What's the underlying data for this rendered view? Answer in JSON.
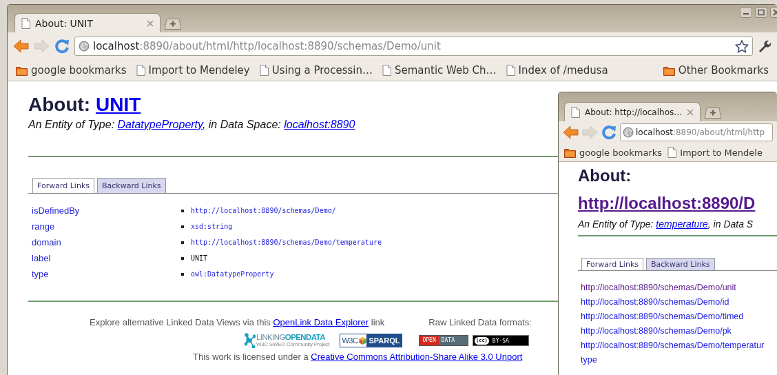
{
  "windows": [
    {
      "kind": "main",
      "tabs": [
        {
          "title": "About: UNIT",
          "selected": true
        }
      ],
      "nav": [
        {
          "kind": "back",
          "disabled": false
        },
        {
          "kind": "forward",
          "disabled": true
        },
        {
          "kind": "reload",
          "disabled": false
        }
      ],
      "address": {
        "host": "localhost",
        "rest": ":8890/about/html/http/localhost:8890/schemas/Demo/unit"
      },
      "bookmarks": [
        {
          "kind": "folder",
          "label": "google bookmarks"
        },
        {
          "kind": "page",
          "label": "Import to Mendeley"
        },
        {
          "kind": "page",
          "label": "Using a Processin…"
        },
        {
          "kind": "page",
          "label": "Semantic Web Ch…"
        },
        {
          "kind": "page",
          "label": "Index of /medusa"
        }
      ],
      "other_bookmarks": "Other Bookmarks",
      "page": {
        "kind": "properties",
        "heading": "About:",
        "heading_link": {
          "text": "UNIT",
          "visited": false
        },
        "subtitle": [
          {
            "text": "An Entity of Type: ",
            "link": false
          },
          {
            "text": "DatatypeProperty",
            "link": true
          },
          {
            "text": ", in Data Space: ",
            "link": false
          },
          {
            "text": "localhost:8890",
            "link": true
          }
        ],
        "link_tabs": [
          {
            "label": "Forward Links",
            "selected": true
          },
          {
            "label": "Backward Links",
            "selected": false
          }
        ],
        "properties": [
          {
            "name": "isDefinedBy",
            "values": [
              {
                "text": "http://localhost:8890/schemas/Demo/",
                "link": true
              }
            ]
          },
          {
            "name": "range",
            "values": [
              {
                "text": "xsd:string",
                "link": true
              }
            ]
          },
          {
            "name": "domain",
            "values": [
              {
                "text": "http://localhost:8890/schemas/Demo/temperature",
                "link": true
              }
            ]
          },
          {
            "name": "label",
            "values": [
              {
                "text": "UNIT",
                "link": false
              }
            ]
          },
          {
            "name": "type",
            "values": [
              {
                "text": "owl:DatatypeProperty",
                "link": true
              }
            ]
          }
        ],
        "footer": {
          "explore": [
            {
              "text": "Explore alternative Linked Data Views via this ",
              "link": false
            },
            {
              "text": "OpenLink Data Explorer",
              "link": true
            },
            {
              "text": " link",
              "link": false
            }
          ],
          "raw_formats": "Raw Linked Data formats:",
          "badges": [
            {
              "kind": "lod",
              "texts": [
                "LINKING",
                "OPENDATA",
                "W3C SWEO Community Project"
              ]
            },
            {
              "kind": "sparql",
              "texts": [
                "W3C",
                "SPARQL"
              ]
            },
            {
              "kind": "opendata",
              "texts": [
                "OPEN",
                "DATA"
              ]
            },
            {
              "kind": "cc",
              "texts": [
                "(cc)",
                "BY-SA"
              ]
            }
          ],
          "license": [
            {
              "text": "This work is licensed under a ",
              "link": false
            },
            {
              "text": "Creative Commons Attribution-Share Alike 3.0 Unport",
              "link": true
            }
          ]
        }
      }
    },
    {
      "kind": "popup",
      "tabs": [
        {
          "title": "About: http://localhos…",
          "selected": true
        }
      ],
      "nav": [
        {
          "kind": "back",
          "disabled": false
        },
        {
          "kind": "forward",
          "disabled": true
        },
        {
          "kind": "reload",
          "disabled": false
        }
      ],
      "address": {
        "host": "localhost",
        "rest": ":8890/about/html/http"
      },
      "bookmarks": [
        {
          "kind": "folder",
          "label": "google bookmarks"
        },
        {
          "kind": "page",
          "label": "Import to Mendele"
        }
      ],
      "page": {
        "kind": "links",
        "heading": "About:",
        "heading_link": {
          "text": "http://localhost:8890/D",
          "visited": true
        },
        "subtitle": [
          {
            "text": "An Entity of Type: ",
            "link": false
          },
          {
            "text": "temperature",
            "link": true
          },
          {
            "text": ", in Data S",
            "link": false
          }
        ],
        "link_tabs": [
          {
            "label": "Forward Links",
            "selected": true
          },
          {
            "label": "Backward Links",
            "selected": false
          }
        ],
        "links": [
          {
            "text": "http://localhost:8890/schemas/Demo/unit",
            "visited": true
          },
          {
            "text": "http://localhost:8890/schemas/Demo/id",
            "visited": false
          },
          {
            "text": "http://localhost:8890/schemas/Demo/timed",
            "visited": false
          },
          {
            "text": "http://localhost:8890/schemas/Demo/pk",
            "visited": false
          },
          {
            "text": "http://localhost:8890/schemas/Demo/temperatur",
            "visited": false
          },
          {
            "text": "type",
            "visited": false
          }
        ]
      }
    }
  ]
}
